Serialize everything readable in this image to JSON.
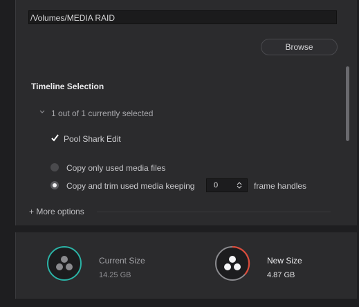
{
  "destination": {
    "path": "/Volumes/MEDIA RAID",
    "browse_label": "Browse"
  },
  "timeline_selection": {
    "title": "Timeline Selection",
    "count_text": "1 out of 1 currently selected",
    "timeline_name": "Pool Shark Edit",
    "timeline_checked": true
  },
  "media_options": {
    "option_used_files": "Copy only used media files",
    "option_trim": "Copy and trim used media keeping",
    "selected_option": "option_trim",
    "frame_handles_value": "0",
    "frame_handles_label": "frame handles",
    "more_options_label": "+ More options"
  },
  "sizes": {
    "current_label": "Current Size",
    "current_value": "14.25 GB",
    "new_label": "New Size",
    "new_value": "4.87 GB",
    "current_ring_color": "#2bb3a6",
    "new_ring_color": "#d94a3a",
    "icon": "davinci-resolve-icon"
  }
}
